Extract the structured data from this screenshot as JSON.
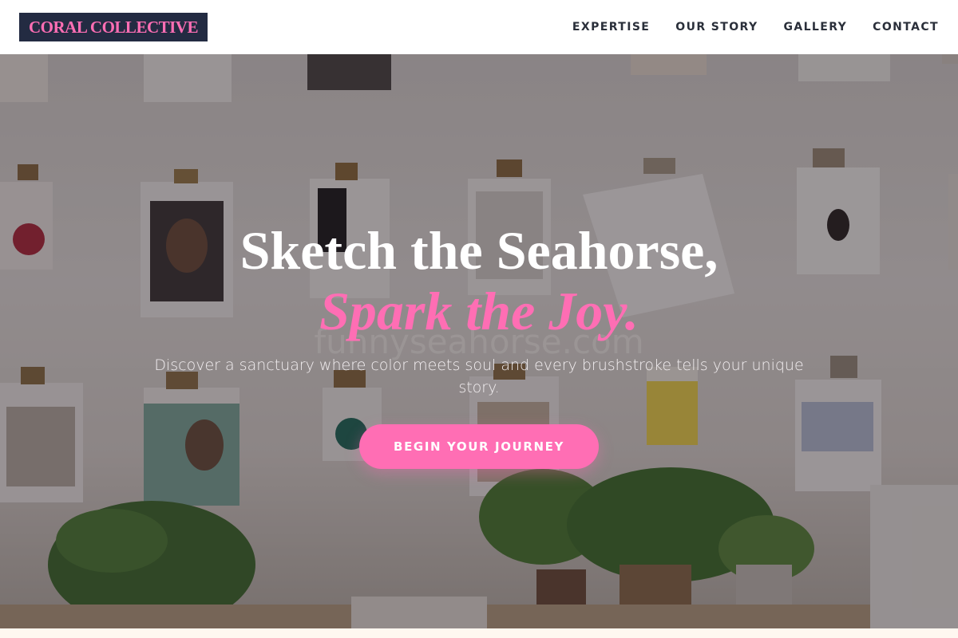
{
  "header": {
    "logo": "CORAL COLLECTIVE",
    "nav": [
      "EXPERTISE",
      "OUR STORY",
      "GALLERY",
      "CONTACT"
    ]
  },
  "hero": {
    "headline_line1": "Sketch the Seahorse,",
    "headline_line2": "Spark the Joy.",
    "subtitle": "Discover a sanctuary where color meets soul and every brushstroke tells your unique story.",
    "cta": "BEGIN YOUR JOURNEY",
    "watermark": "funnyseahorse.com"
  },
  "colors": {
    "accent": "#ff6eb4",
    "logo_bg": "#232b42",
    "nav_text": "#2a2f3a"
  }
}
